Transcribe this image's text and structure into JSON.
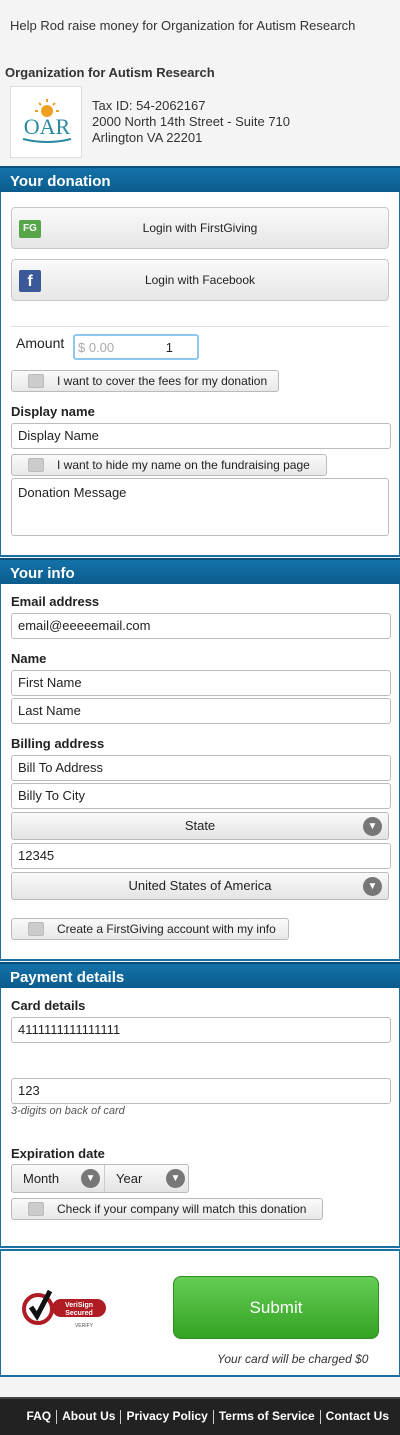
{
  "header": {
    "heading": "Help Rod raise money for Organization for Autism Research",
    "org_name": "Organization for Autism Research",
    "tax_id": "Tax ID: 54-2062167",
    "address_line1": "2000 North 14th Street - Suite 710",
    "address_line2": "Arlington VA 22201",
    "logo_text": "OAR"
  },
  "donation": {
    "section_title": "Your donation",
    "login_firstgiving": "Login with FirstGiving",
    "fg_icon": "FG",
    "login_facebook": "Login with Facebook",
    "fb_icon": "f",
    "amount_label": "Amount",
    "amount_currency": "$ 0.00",
    "amount_value": "1",
    "cover_fees_label": "I want to cover the fees for my donation",
    "display_name_label": "Display name",
    "display_name_value": "Display Name",
    "hide_name_label": "I want to hide my name on the fundraising page",
    "message_value": "Donation Message"
  },
  "info": {
    "section_title": "Your info",
    "email_label": "Email address",
    "email_value": "email@eeeeemail.com",
    "name_label": "Name",
    "first_name_value": "First Name",
    "last_name_value": "Last Name",
    "billing_label": "Billing address",
    "address_value": "Bill To Address",
    "city_value": "Billy To City",
    "state_value": "State",
    "zip_value": "12345",
    "country_value": "United States of America",
    "create_account_label": "Create a FirstGiving account with my info"
  },
  "payment": {
    "section_title": "Payment details",
    "card_label": "Card details",
    "card_value": "4111111111111111",
    "security_value": "123",
    "security_hint": "3-digits on back of card",
    "expiration_label": "Expiration date",
    "month_value": "Month",
    "year_value": "Year",
    "company_match_label": "Check if your company will match this donation"
  },
  "submit": {
    "button_label": "Submit",
    "charge_note": "Your card will be charged $0",
    "verisign_line1": "VeriSign",
    "verisign_line2": "Secured",
    "verisign_line3": "VERIFY"
  },
  "footer": {
    "links": [
      "FAQ",
      "About Us",
      "Privacy Policy",
      "Terms of Service",
      "Contact Us"
    ]
  },
  "colors": {
    "section_bar": "#0b5c8d",
    "submit_green": "#34a323",
    "footer_bg": "#222222"
  }
}
